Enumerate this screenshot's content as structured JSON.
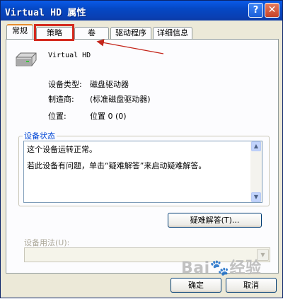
{
  "window": {
    "title": "Virtual HD 属性",
    "help_glyph": "?",
    "close_glyph": "✕"
  },
  "tabs": [
    {
      "label": "常规",
      "active": true
    },
    {
      "label": "策略",
      "active": false,
      "highlighted": true
    },
    {
      "label": "卷",
      "active": false
    },
    {
      "label": "驱动程序",
      "active": false
    },
    {
      "label": "详细信息",
      "active": false
    }
  ],
  "device": {
    "icon": "hard-disk-icon",
    "name": "Virtual HD",
    "type_label": "设备类型:",
    "type_value": "磁盘驱动器",
    "manufacturer_label": "制造商:",
    "manufacturer_value": "(标准磁盘驱动器)",
    "location_label": "位置:",
    "location_value": "位置 0 (0)"
  },
  "status": {
    "group_title": "设备状态",
    "line1": "这个设备运转正常。",
    "line2": "若此设备有问题，单击“疑难解答”来启动疑难解答。",
    "troubleshoot_button": "疑难解答(T)..."
  },
  "usage": {
    "label": "设备用法(U):",
    "value": ""
  },
  "footer": {
    "ok_button": "确定",
    "cancel_button": "取消"
  },
  "annotation": {
    "highlight_color": "#d42a1e"
  },
  "watermark": {
    "text": "Bai🐾经验"
  },
  "colors": {
    "titlebar": "#0548c5",
    "group_title": "#0046d5",
    "tab_focus": "#e68b2c"
  }
}
